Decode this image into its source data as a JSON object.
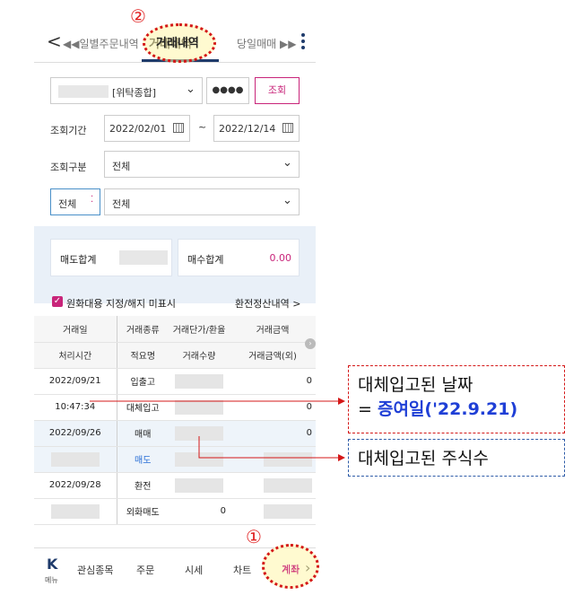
{
  "topbar": {
    "back_symbol": "<",
    "prev_tab": "◀◀일별주문내역",
    "active_tab": "거래내역",
    "next_tab": "당일매매 ▶▶"
  },
  "annotations": {
    "circle_2": "②",
    "circle_1": "①"
  },
  "filters": {
    "account_type": "[위탁종합]",
    "password_mask": "●●●●",
    "query_button": "조회",
    "period_label": "조회기간",
    "date_from": "2022/02/01",
    "tilde": "~",
    "date_to": "2022/12/14",
    "category_label": "조회구분",
    "category_value": "전체",
    "sub_left": "전체",
    "sub_right": "전체"
  },
  "summary": {
    "sell_label": "매도합계",
    "buy_label": "매수합계",
    "buy_value": "0.00"
  },
  "options": {
    "fx_check_label": "원화대용 지정/해지 미표시",
    "fx_link": "환전정산내역 >"
  },
  "table": {
    "header1": [
      "거래일",
      "거래종류",
      "거래단가/환율",
      "거래금액"
    ],
    "header2": [
      "처리시간",
      "적요명",
      "거래수량",
      "거래금액(외)"
    ],
    "rows": [
      {
        "c1": "2022/09/21",
        "c2": "입출고",
        "c4": "0"
      },
      {
        "c1": "10:47:34",
        "c2": "대체입고",
        "c4": "0"
      },
      {
        "c1": "2022/09/26",
        "c2": "매매",
        "c4": "0"
      },
      {
        "c1": "",
        "c2": "매도",
        "c4": ""
      },
      {
        "c1": "2022/09/28",
        "c2": "환전",
        "c4": ""
      },
      {
        "c1": "",
        "c2": "외화매도",
        "c3": "0",
        "c4": ""
      }
    ]
  },
  "bottomnav": {
    "k": "K",
    "menu": "메뉴",
    "items": [
      "관심종목",
      "주문",
      "시세",
      "차트",
      "계좌"
    ]
  },
  "callouts": {
    "date_line1": "대체입고된 날짜",
    "date_prefix": "= ",
    "date_highlight": "증여일('22.9.21)",
    "qty": "대체입고된 주식수"
  },
  "colors": {
    "accent_pink": "#c8257a",
    "annotation_red": "#d41818",
    "highlight_blue": "#1f3fd6",
    "nav_blue": "#1f3b6b"
  }
}
